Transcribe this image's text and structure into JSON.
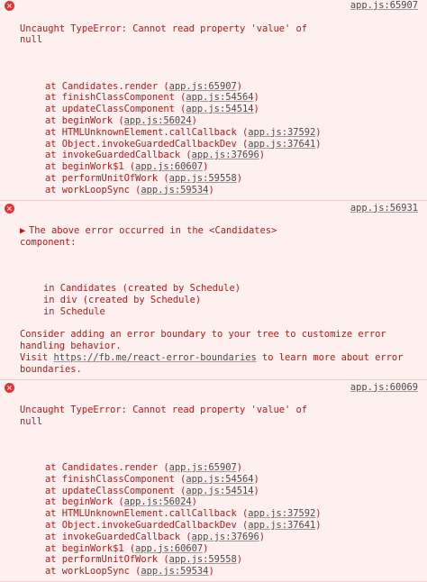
{
  "colors": {
    "background": "#fdf0ef",
    "error_text": "#b21a1a",
    "link": "#4b4b4b",
    "icon": "#e3342f",
    "divider": "#f3c9c6"
  },
  "error1": {
    "message": "Uncaught TypeError: Cannot read property 'value' of null",
    "source": "app.js:65907",
    "frames": [
      {
        "at": "at Candidates.render (",
        "loc": "app.js:65907",
        "end": ")"
      },
      {
        "at": "at finishClassComponent (",
        "loc": "app.js:54564",
        "end": ")"
      },
      {
        "at": "at updateClassComponent (",
        "loc": "app.js:54514",
        "end": ")"
      },
      {
        "at": "at beginWork (",
        "loc": "app.js:56024",
        "end": ")"
      },
      {
        "at": "at HTMLUnknownElement.callCallback (",
        "loc": "app.js:37592",
        "end": ")"
      },
      {
        "at": "at Object.invokeGuardedCallbackDev (",
        "loc": "app.js:37641",
        "end": ")"
      },
      {
        "at": "at invokeGuardedCallback (",
        "loc": "app.js:37696",
        "end": ")"
      },
      {
        "at": "at beginWork$1 (",
        "loc": "app.js:60607",
        "end": ")"
      },
      {
        "at": "at performUnitOfWork (",
        "loc": "app.js:59558",
        "end": ")"
      },
      {
        "at": "at workLoopSync (",
        "loc": "app.js:59534",
        "end": ")"
      }
    ]
  },
  "error2": {
    "message": "The above error occurred in the <Candidates> component:",
    "source": "app.js:56931",
    "stack": [
      "in Candidates (created by Schedule)",
      "in div (created by Schedule)",
      "in Schedule"
    ],
    "advice": "Consider adding an error boundary to your tree to customize error handling behavior.",
    "visit_prefix": "Visit ",
    "visit_url": "https://fb.me/react-error-boundaries",
    "visit_suffix": " to learn more about error boundaries."
  },
  "error3": {
    "message": "Uncaught TypeError: Cannot read property 'value' of null",
    "source": "app.js:60069",
    "frames": [
      {
        "at": "at Candidates.render (",
        "loc": "app.js:65907",
        "end": ")"
      },
      {
        "at": "at finishClassComponent (",
        "loc": "app.js:54564",
        "end": ")"
      },
      {
        "at": "at updateClassComponent (",
        "loc": "app.js:54514",
        "end": ")"
      },
      {
        "at": "at beginWork (",
        "loc": "app.js:56024",
        "end": ")"
      },
      {
        "at": "at HTMLUnknownElement.callCallback (",
        "loc": "app.js:37592",
        "end": ")"
      },
      {
        "at": "at Object.invokeGuardedCallbackDev (",
        "loc": "app.js:37641",
        "end": ")"
      },
      {
        "at": "at invokeGuardedCallback (",
        "loc": "app.js:37696",
        "end": ")"
      },
      {
        "at": "at beginWork$1 (",
        "loc": "app.js:60607",
        "end": ")"
      },
      {
        "at": "at performUnitOfWork (",
        "loc": "app.js:59558",
        "end": ")"
      },
      {
        "at": "at workLoopSync (",
        "loc": "app.js:59534",
        "end": ")"
      }
    ]
  },
  "icons": {
    "error": "error-icon",
    "expand": "expand-triangle-icon"
  }
}
